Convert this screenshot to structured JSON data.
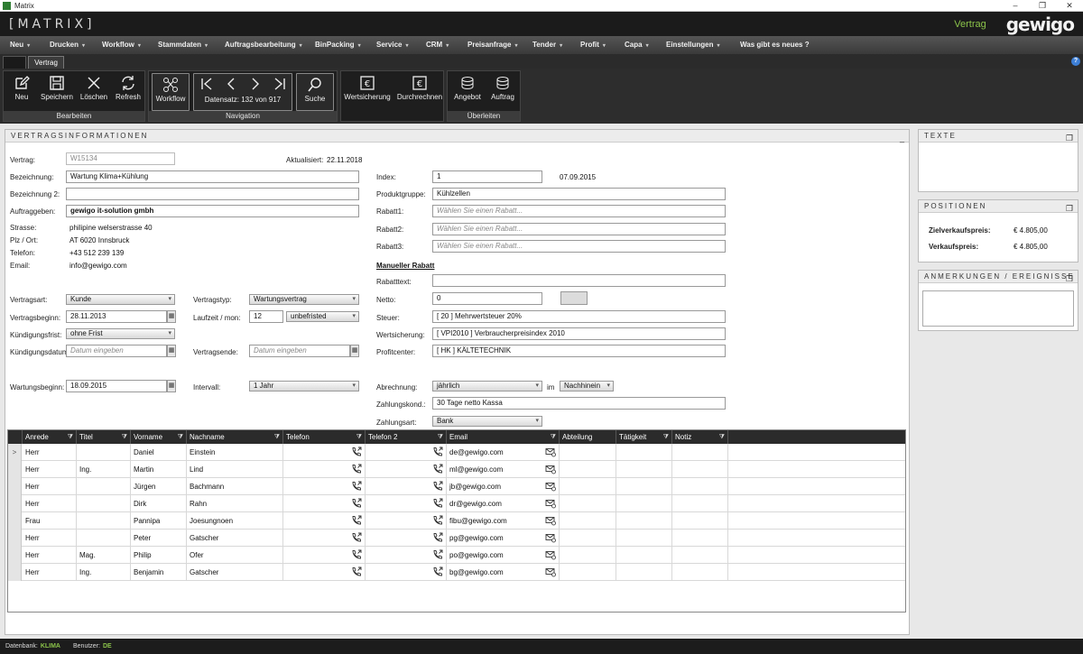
{
  "window": {
    "title": "Matrix",
    "min": "–",
    "restore": "❐",
    "close": "✕"
  },
  "brand": {
    "app_name": "[MATRIX]",
    "context": "Vertrag",
    "logo": "gewigo"
  },
  "menu": [
    {
      "label": "Neu"
    },
    {
      "label": "Drucken"
    },
    {
      "label": "Workflow"
    },
    {
      "label": "Stammdaten"
    },
    {
      "label": "Auftragsbearbeitung"
    },
    {
      "label": "BinPacking"
    },
    {
      "label": "Service"
    },
    {
      "label": "CRM"
    },
    {
      "label": "Preisanfrage"
    },
    {
      "label": "Tender"
    },
    {
      "label": "Profit"
    },
    {
      "label": "Capa"
    },
    {
      "label": "Einstellungen"
    },
    {
      "label": "Was gibt es neues ?"
    }
  ],
  "tabs": {
    "active": "Vertrag",
    "help": "?"
  },
  "ribbon": {
    "bearbeiten": {
      "label": "Bearbeiten",
      "neu": "Neu",
      "speichern": "Speichern",
      "loeschen": "Löschen",
      "refresh": "Refresh"
    },
    "workflow": "Workflow",
    "navigation": {
      "label": "Navigation",
      "datensatz": "Datensatz:  132 von 917",
      "suche": "Suche"
    },
    "calc": {
      "wertsicherung": "Wertsicherung",
      "durchrechnen": "Durchrechnen"
    },
    "ueberleiten": {
      "label": "Überleiten",
      "angebot": "Angebot",
      "auftrag": "Auftrag"
    }
  },
  "vertrag": {
    "title": "VERTRAGSINFORMATIONEN",
    "collapse": "_",
    "vertrag_label": "Vertrag:",
    "vertrag_value": "W15134",
    "aktualisiert_label": "Aktualisiert:",
    "aktualisiert_value": "22.11.2018",
    "bezeichnung_label": "Bezeichnung:",
    "bezeichnung_value": "Wartung Klima+Kühlung",
    "bezeichnung2_label": "Bezeichnung 2:",
    "bezeichnung2_value": "",
    "auftraggeber_label": "Auftraggeben:",
    "auftraggeber_value": "gewigo it-solution gmbh",
    "strasse_label": "Strasse:",
    "strasse_value": "philipine welserstrasse 40",
    "plz_label": "Plz / Ort:",
    "plz_value": "AT 6020 Innsbruck",
    "telefon_label": "Telefon:",
    "telefon_value": "+43 512 239 139",
    "email_label": "Email:",
    "email_value": "info@gewigo.com",
    "vertragsart_label": "Vertragsart:",
    "vertragsart_value": "Kunde",
    "vertragstyp_label": "Vertragstyp:",
    "vertragstyp_value": "Wartungsvertrag",
    "vertragsbeginn_label": "Vertragsbeginn:",
    "vertragsbeginn_value": "28.11.2013",
    "laufzeit_label": "Laufzeit / mon:",
    "laufzeit_value": "12",
    "laufzeit_select": "unbefristed",
    "kuendigungsfrist_label": "Kündigungsfrist:",
    "kuendigungsfrist_value": "ohne Frist",
    "kuendigungsdatum_label": "Kündigungsdatum:",
    "kuendigungsdatum_placeholder": "Datum eingeben",
    "vertragsende_label": "Vertragsende:",
    "vertragsende_placeholder": "Datum eingeben",
    "wartungsbeginn_label": "Wartungsbeginn:",
    "wartungsbeginn_value": "18.09.2015",
    "intervall_label": "Intervall:",
    "intervall_value": "1  Jahr",
    "index_label": "Index:",
    "index_value": "1",
    "index_date": "07.09.2015",
    "produktgruppe_label": "Produktgruppe:",
    "produktgruppe_value": "Kühlzellen",
    "rabatt1_label": "Rabatt1:",
    "rabatt2_label": "Rabatt2:",
    "rabatt3_label": "Rabatt3:",
    "rabatt_placeholder": "Wählen Sie einen Rabatt...",
    "manueller_rabatt": "Manueller Rabatt",
    "rabatttext_label": "Rabatttext:",
    "rabatttext_value": "",
    "netto_label": "Netto:",
    "netto_value": "0",
    "steuer_label": "Steuer:",
    "steuer_value": "[ 20 ] Mehrwertsteuer 20%",
    "wertsicherung_label": "Wertsicherung:",
    "wertsicherung_value": "[ VPI2010 ] Verbraucherpreisindex 2010",
    "profitcenter_label": "Profitcenter:",
    "profitcenter_value": "[ HK ] KÄLTETECHNIK",
    "abrechnung_label": "Abrechnung:",
    "abrechnung_value": "jährlich",
    "im_label": "im",
    "im_value": "Nachhinein",
    "zahlungskond_label": "Zahlungskond.:",
    "zahlungskond_value": "30 Tage netto Kassa",
    "zahlungsart_label": "Zahlungsart:",
    "zahlungsart_value": "Bank"
  },
  "grid": {
    "columns": [
      "Anrede",
      "Titel",
      "Vorname",
      "Nachname",
      "Telefon",
      "Telefon 2",
      "Email",
      "Abteilung",
      "Tätigkeit",
      "Notiz"
    ],
    "filter_icon": "⧩",
    "current_row_marker": ">",
    "rows": [
      {
        "anrede": "Herr",
        "titel": "",
        "vorname": "Daniel",
        "nachname": "Einstein",
        "email": "de@gewigo.com"
      },
      {
        "anrede": "Herr",
        "titel": "Ing.",
        "vorname": "Martin",
        "nachname": "Lind",
        "email": "ml@gewigo.com"
      },
      {
        "anrede": "Herr",
        "titel": "",
        "vorname": "Jürgen",
        "nachname": "Bachmann",
        "email": "jb@gewigo.com"
      },
      {
        "anrede": "Herr",
        "titel": "",
        "vorname": "Dirk",
        "nachname": "Rahn",
        "email": "dr@gewigo.com"
      },
      {
        "anrede": "Frau",
        "titel": "",
        "vorname": "Pannipa",
        "nachname": "Joesungnoen",
        "email": "fibu@gewigo.com"
      },
      {
        "anrede": "Herr",
        "titel": "",
        "vorname": "Peter",
        "nachname": "Gatscher",
        "email": "pg@gewigo.com"
      },
      {
        "anrede": "Herr",
        "titel": "Mag.",
        "vorname": "Philip",
        "nachname": "Ofer",
        "email": "po@gewigo.com"
      },
      {
        "anrede": "Herr",
        "titel": "Ing.",
        "vorname": "Benjamin",
        "nachname": "Gatscher",
        "email": "bg@gewigo.com"
      }
    ]
  },
  "side": {
    "texte_title": "TEXTE",
    "positionen_title": "POSITIONEN",
    "zielverkauf_label": "Zielverkaufspreis:",
    "zielverkauf_value": "€ 4.805,00",
    "verkauf_label": "Verkaufspreis:",
    "verkauf_value": "€ 4.805,00",
    "anmerkungen_title": "ANMERKUNGEN / EREIGNISSE",
    "expand_icon": "❐"
  },
  "status": {
    "datenbank_label": "Datenbank:",
    "datenbank_value": "KLIMA",
    "benutzer_label": "Benutzer:",
    "benutzer_value": "DE"
  }
}
